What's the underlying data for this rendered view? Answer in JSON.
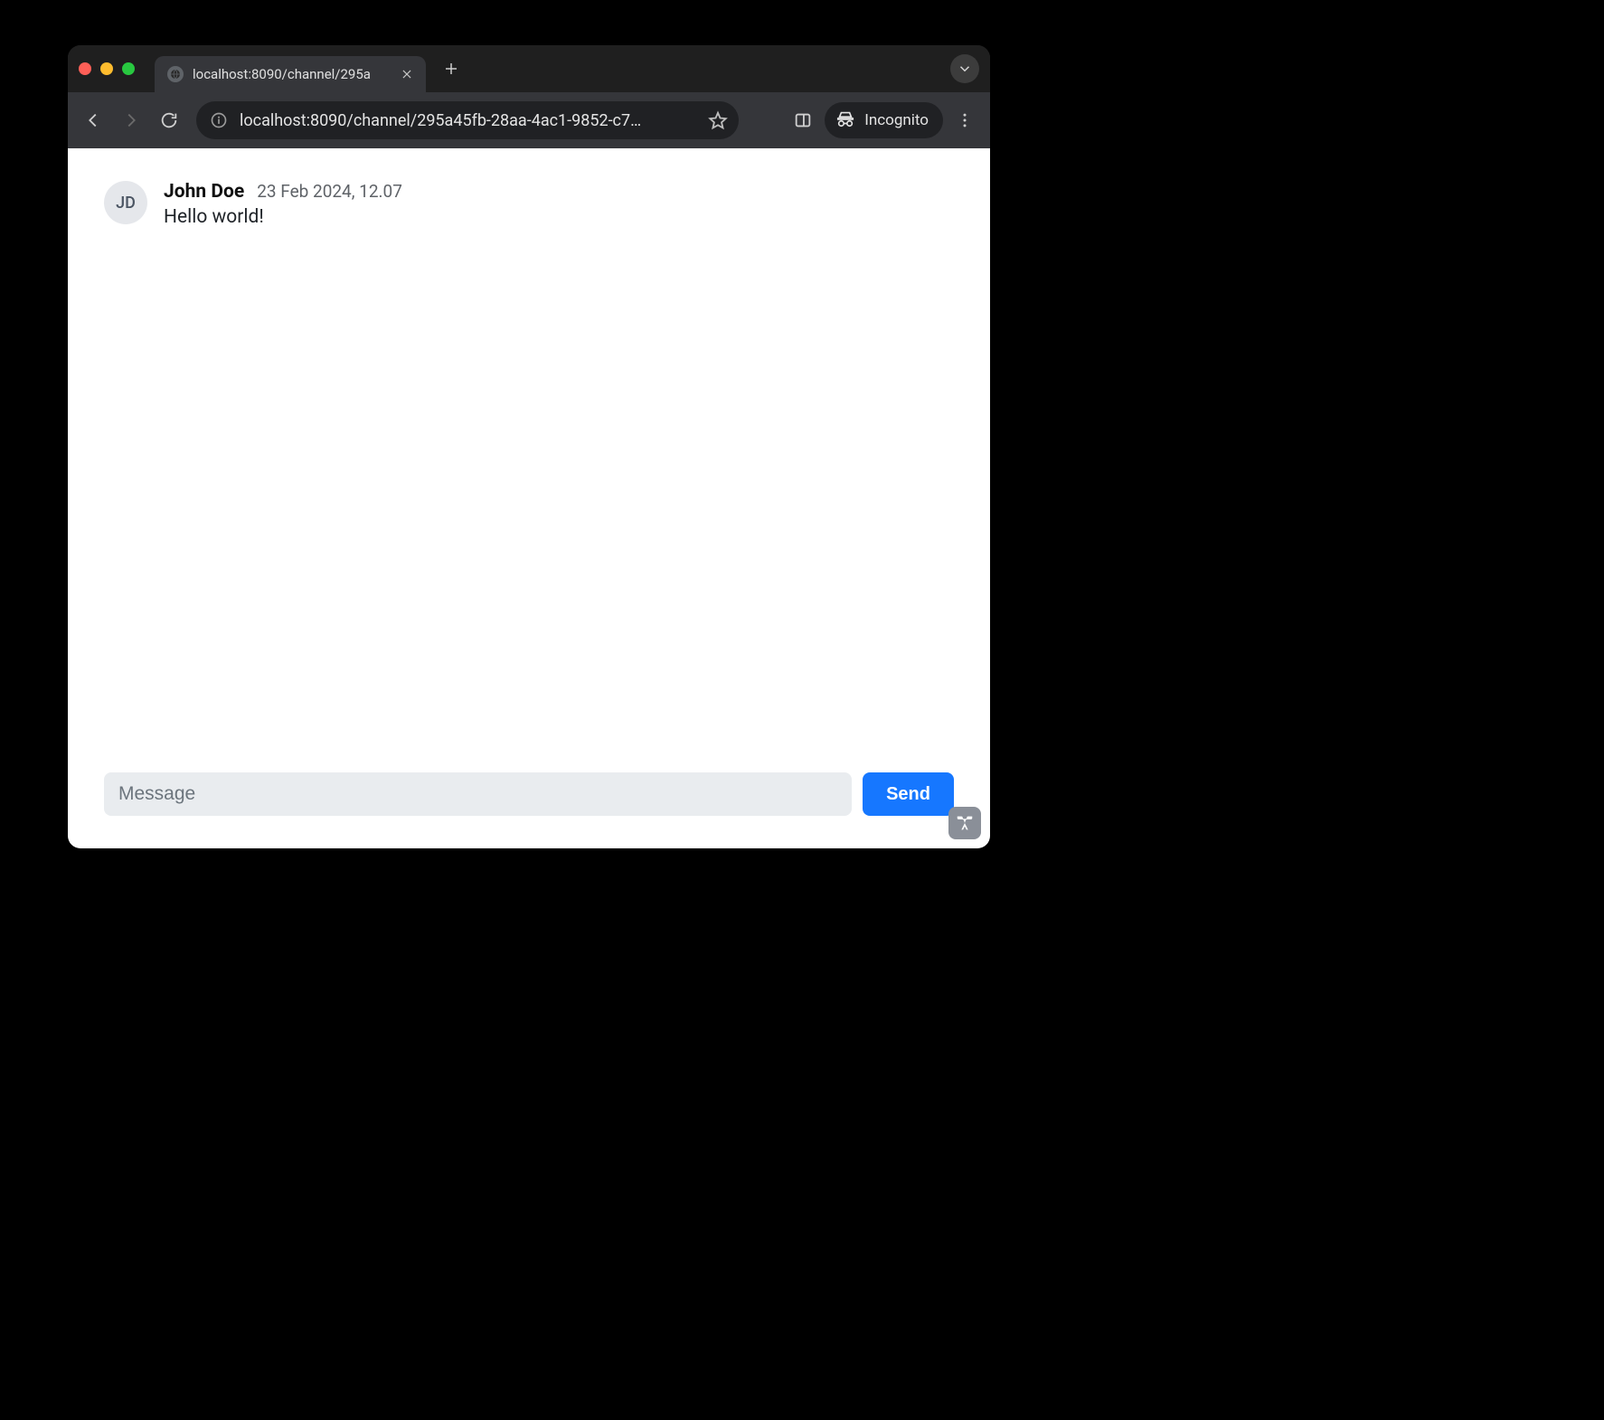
{
  "browser": {
    "tab_title": "localhost:8090/channel/295a",
    "url": "localhost:8090/channel/295a45fb-28aa-4ac1-9852-c7…",
    "incognito_label": "Incognito"
  },
  "chat": {
    "messages": [
      {
        "initials": "JD",
        "author": "John Doe",
        "timestamp": "23 Feb 2024, 12.07",
        "text": "Hello world!"
      }
    ],
    "composer_placeholder": "Message",
    "send_label": "Send"
  }
}
